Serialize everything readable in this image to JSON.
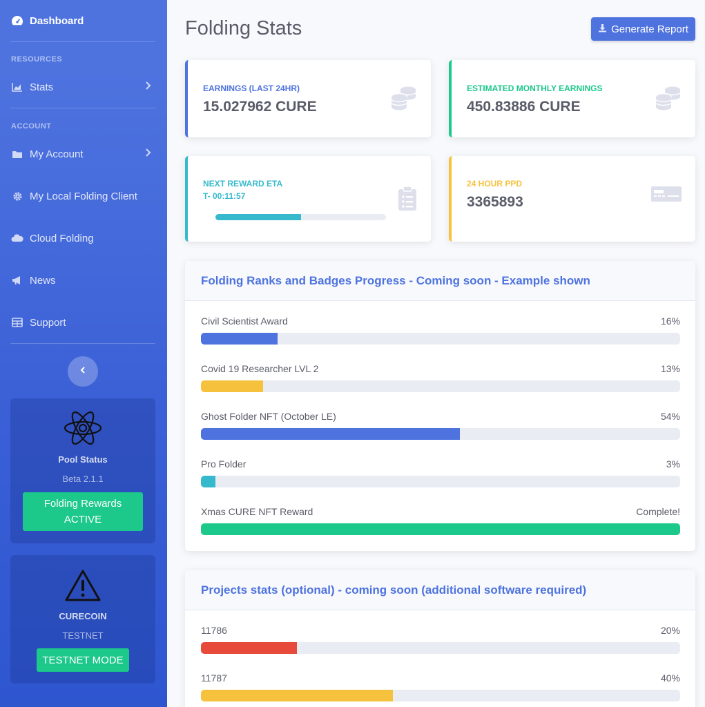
{
  "sidebar": {
    "dashboard": "Dashboard",
    "heading_resources": "RESOURCES",
    "stats": "Stats",
    "heading_account": "ACCOUNT",
    "my_account": "My Account",
    "local_client": "My Local Folding Client",
    "cloud_folding": "Cloud Folding",
    "news": "News",
    "support": "Support",
    "pool_card": {
      "icon": "atom-icon",
      "title": "Pool Status",
      "version": "Beta 2.1.1",
      "button_line1": "Folding Rewards",
      "button_line2": "ACTIVE"
    },
    "coin_card": {
      "icon": "warning-icon",
      "title": "CURECOIN",
      "subtitle": "TESTNET",
      "button": "TESTNET MODE"
    }
  },
  "header": {
    "title": "Folding Stats",
    "generate_report": "Generate Report"
  },
  "cards": {
    "earnings": {
      "label": "EARNINGS (LAST 24HR)",
      "value": "15.027962 CURE",
      "color": "#4e73df",
      "icon": "coins-icon"
    },
    "monthly": {
      "label": "ESTIMATED MONTHLY EARNINGS",
      "value": "450.83886 CURE",
      "color": "#1cc88a",
      "icon": "coins-icon"
    },
    "reward_eta": {
      "label": "NEXT REWARD ETA",
      "value": "T- 00:11:57",
      "color": "#36b9cc",
      "progress": 0.5,
      "icon": "clipboard-list-icon"
    },
    "ppd": {
      "label": "24 HOUR PPD",
      "value": "3365893",
      "color": "#f6c23e",
      "icon": "money-check-icon"
    }
  },
  "ranks_panel": {
    "title": "Folding Ranks and Badges Progress - Coming soon - Example shown",
    "items": [
      {
        "name": "Civil Scientist Award",
        "pct_label": "16%",
        "progress": 0.16,
        "color": "#4e73df"
      },
      {
        "name": "Covid 19 Researcher LVL 2",
        "pct_label": "13%",
        "progress": 0.13,
        "color": "#f6c23e"
      },
      {
        "name": "Ghost Folder NFT (October LE)",
        "pct_label": "54%",
        "progress": 0.54,
        "color": "#4e73df"
      },
      {
        "name": "Pro Folder",
        "pct_label": "3%",
        "progress": 0.03,
        "color": "#36b9cc"
      },
      {
        "name": "Xmas CURE NFT Reward",
        "pct_label": "Complete!",
        "progress": 1.0,
        "color": "#1cc88a"
      }
    ]
  },
  "projects_panel": {
    "title": "Projects stats (optional) - coming soon (additional software required)",
    "items": [
      {
        "name": "11786",
        "pct_label": "20%",
        "progress": 0.2,
        "color": "#e74a3b"
      },
      {
        "name": "11787",
        "pct_label": "40%",
        "progress": 0.4,
        "color": "#f6c23e"
      }
    ]
  }
}
